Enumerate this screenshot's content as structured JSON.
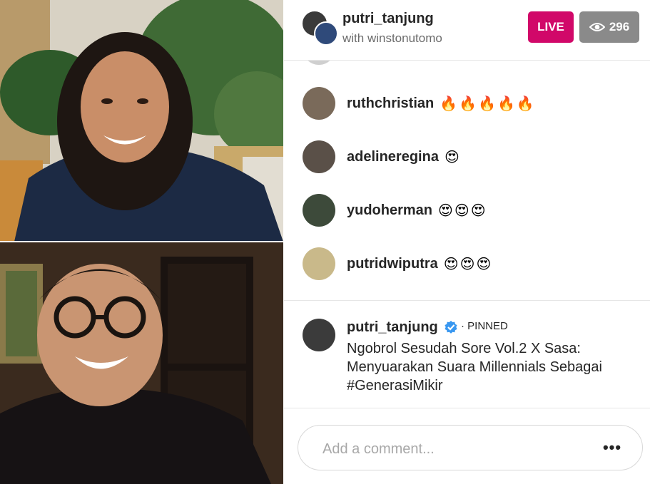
{
  "video": {
    "top_participant_label": "",
    "bottom_participant_label": ""
  },
  "header": {
    "host_username": "putri_tanjung",
    "with_text": "with winstonutomo",
    "live_label": "LIVE",
    "viewer_count": "296",
    "live_color": "#d10869",
    "viewer_color": "#8a8a8a"
  },
  "comments": [
    {
      "username": "ruthchristian",
      "text": "🔥🔥🔥🔥🔥",
      "avatar_color": "#7a6a5a"
    },
    {
      "username": "adelineregina",
      "text": "😍",
      "avatar_color": "#5a5048"
    },
    {
      "username": "yudoherman",
      "text": "😍😍😍",
      "avatar_color": "#3d4a3a"
    },
    {
      "username": "putridwiputra",
      "text": "😍😍😍",
      "avatar_color": "#c9b98a"
    }
  ],
  "pinned": {
    "username": "putri_tanjung",
    "label": "· PINNED",
    "text": "Ngobrol Sesudah Sore Vol.2 X Sasa: Menyuarakan Suara Millennials Sebagai #GenerasiMikir"
  },
  "composer": {
    "placeholder": "Add a comment...",
    "more_label": "•••"
  }
}
